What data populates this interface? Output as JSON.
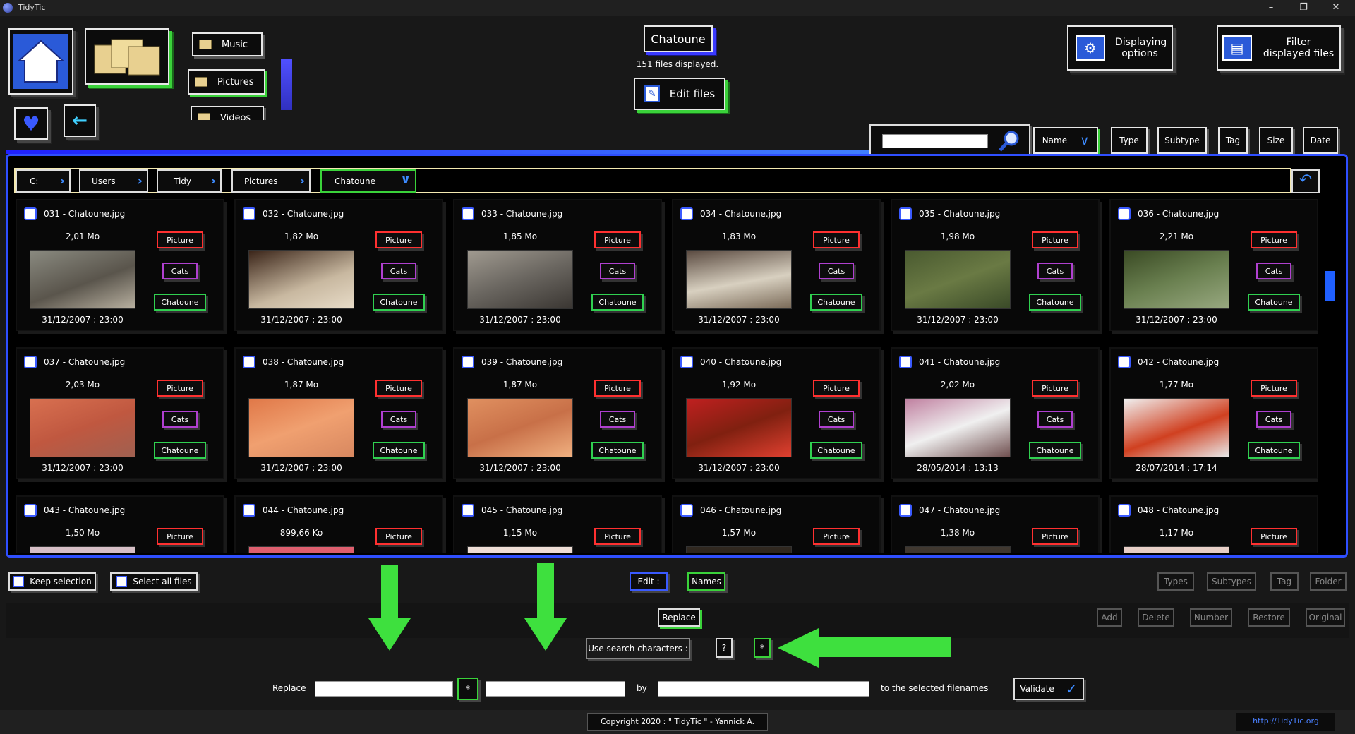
{
  "window": {
    "title": "TidyTic",
    "controls": [
      "–",
      "❐",
      "✕"
    ]
  },
  "top": {
    "folders": [
      "Music",
      "Pictures",
      "Videos"
    ],
    "current_folder": "Chatoune",
    "files_displayed": "151 files displayed.",
    "edit_files": "Edit files",
    "displaying_options": "Displaying options",
    "filter_files": "Filter displayed files"
  },
  "sort": {
    "name": "Name",
    "type": "Type",
    "subtype": "Subtype",
    "tag": "Tag",
    "size": "Size",
    "date": "Date"
  },
  "path": {
    "crumbs": [
      "C:",
      "Users",
      "Tidy",
      "Pictures",
      "Chatoune"
    ]
  },
  "files": [
    {
      "name": "031 - Chatoune.jpg",
      "size": "2,01 Mo",
      "date": "31/12/2007 : 23:00",
      "type": "Picture",
      "subtype": "Cats",
      "tag": "Chatoune"
    },
    {
      "name": "032 - Chatoune.jpg",
      "size": "1,82 Mo",
      "date": "31/12/2007 : 23:00",
      "type": "Picture",
      "subtype": "Cats",
      "tag": "Chatoune"
    },
    {
      "name": "033 - Chatoune.jpg",
      "size": "1,85 Mo",
      "date": "31/12/2007 : 23:00",
      "type": "Picture",
      "subtype": "Cats",
      "tag": "Chatoune"
    },
    {
      "name": "034 - Chatoune.jpg",
      "size": "1,83 Mo",
      "date": "31/12/2007 : 23:00",
      "type": "Picture",
      "subtype": "Cats",
      "tag": "Chatoune"
    },
    {
      "name": "035 - Chatoune.jpg",
      "size": "1,98 Mo",
      "date": "31/12/2007 : 23:00",
      "type": "Picture",
      "subtype": "Cats",
      "tag": "Chatoune"
    },
    {
      "name": "036 - Chatoune.jpg",
      "size": "2,21 Mo",
      "date": "31/12/2007 : 23:00",
      "type": "Picture",
      "subtype": "Cats",
      "tag": "Chatoune"
    },
    {
      "name": "037 - Chatoune.jpg",
      "size": "2,03 Mo",
      "date": "31/12/2007 : 23:00",
      "type": "Picture",
      "subtype": "Cats",
      "tag": "Chatoune"
    },
    {
      "name": "038 - Chatoune.jpg",
      "size": "1,87 Mo",
      "date": "31/12/2007 : 23:00",
      "type": "Picture",
      "subtype": "Cats",
      "tag": "Chatoune"
    },
    {
      "name": "039 - Chatoune.jpg",
      "size": "1,87 Mo",
      "date": "31/12/2007 : 23:00",
      "type": "Picture",
      "subtype": "Cats",
      "tag": "Chatoune"
    },
    {
      "name": "040 - Chatoune.jpg",
      "size": "1,92 Mo",
      "date": "31/12/2007 : 23:00",
      "type": "Picture",
      "subtype": "Cats",
      "tag": "Chatoune"
    },
    {
      "name": "041 - Chatoune.jpg",
      "size": "2,02 Mo",
      "date": "28/05/2014 : 13:13",
      "type": "Picture",
      "subtype": "Cats",
      "tag": "Chatoune"
    },
    {
      "name": "042 - Chatoune.jpg",
      "size": "1,77 Mo",
      "date": "28/07/2014 : 17:14",
      "type": "Picture",
      "subtype": "Cats",
      "tag": "Chatoune"
    },
    {
      "name": "043 - Chatoune.jpg",
      "size": "1,50 Mo",
      "type": "Picture"
    },
    {
      "name": "044 - Chatoune.jpg",
      "size": "899,66 Ko",
      "type": "Picture"
    },
    {
      "name": "045 - Chatoune.jpg",
      "size": "1,15 Mo",
      "type": "Picture"
    },
    {
      "name": "046 - Chatoune.jpg",
      "size": "1,57 Mo",
      "type": "Picture"
    },
    {
      "name": "047 - Chatoune.jpg",
      "size": "1,38 Mo",
      "type": "Picture"
    },
    {
      "name": "048 - Chatoune.jpg",
      "size": "1,17 Mo",
      "type": "Picture"
    }
  ],
  "bottom": {
    "keep_selection": "Keep selection",
    "select_all": "Select all files",
    "edit_label": "Edit :",
    "names": "Names",
    "types": "Types",
    "subtypes": "Subtypes",
    "tag": "Tag",
    "folder": "Folder",
    "replace_btn": "Replace",
    "add": "Add",
    "delete": "Delete",
    "number": "Number",
    "restore": "Restore",
    "original": "Original",
    "use_search_chars": "Use search characters :",
    "q_char": "?",
    "star_char": "*",
    "replace_label": "Replace",
    "sep_star": "*",
    "by_label": "by",
    "suffix": "to the selected filenames",
    "validate": "Validate",
    "copyright": "Copyright 2020 : \" TidyTic \" - Yannick A.",
    "url": "http://TidyTic.org"
  }
}
